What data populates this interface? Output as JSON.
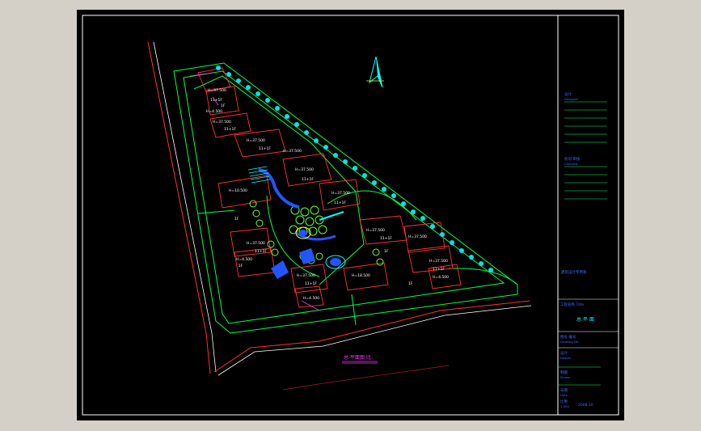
{
  "drawing": {
    "plan_title": "总 平面图 比",
    "north_arrow_icon": "north-arrow-icon",
    "building_labels": [
      "H=37.500",
      "H=4.500",
      "H=37.500",
      "H=37.500",
      "H=37.500",
      "H=10.500",
      "H=37.500",
      "H=37.500",
      "H=4.500",
      "H=37.500",
      "H=4.500",
      "H=37.500",
      "H=37.500",
      "H=18.500",
      "H=37.500",
      "H=4.500",
      "H=37.500"
    ],
    "floor_labels": [
      "11+1F",
      "11+1F",
      "11+1F",
      "11+1F",
      "11+1F",
      "11+1F",
      "11+1F",
      "11+1F",
      "11+1F",
      "1F",
      "1F",
      "1F",
      "1F",
      "1F"
    ]
  },
  "title_block": {
    "colors": {
      "frame": "#ffffff",
      "lines": "#00ff66",
      "text_blue": "#3a6cff",
      "text_cyan": "#00ffff",
      "text_magenta": "#ff33ff",
      "text_red": "#ff3030"
    },
    "section1_label": "设计",
    "section1_sub": "Designer",
    "section2_label": "校对 审核",
    "section2_sub": "Checked",
    "stamp_text": "建筑设计专用章",
    "project_label": "工程名称 Title",
    "drawing_name": "总 平 面",
    "drawing_no_label": "图号 编号",
    "drawing_no_sub": "Drawing No.",
    "row1_label": "设计",
    "row1_sub": "Design",
    "row2_label": "制图",
    "row2_sub": "Drawn",
    "row3_label": "日期",
    "row3_sub": "Date",
    "scale_label": "比例",
    "scale_value": "1:500",
    "date_value": "2006.10"
  }
}
